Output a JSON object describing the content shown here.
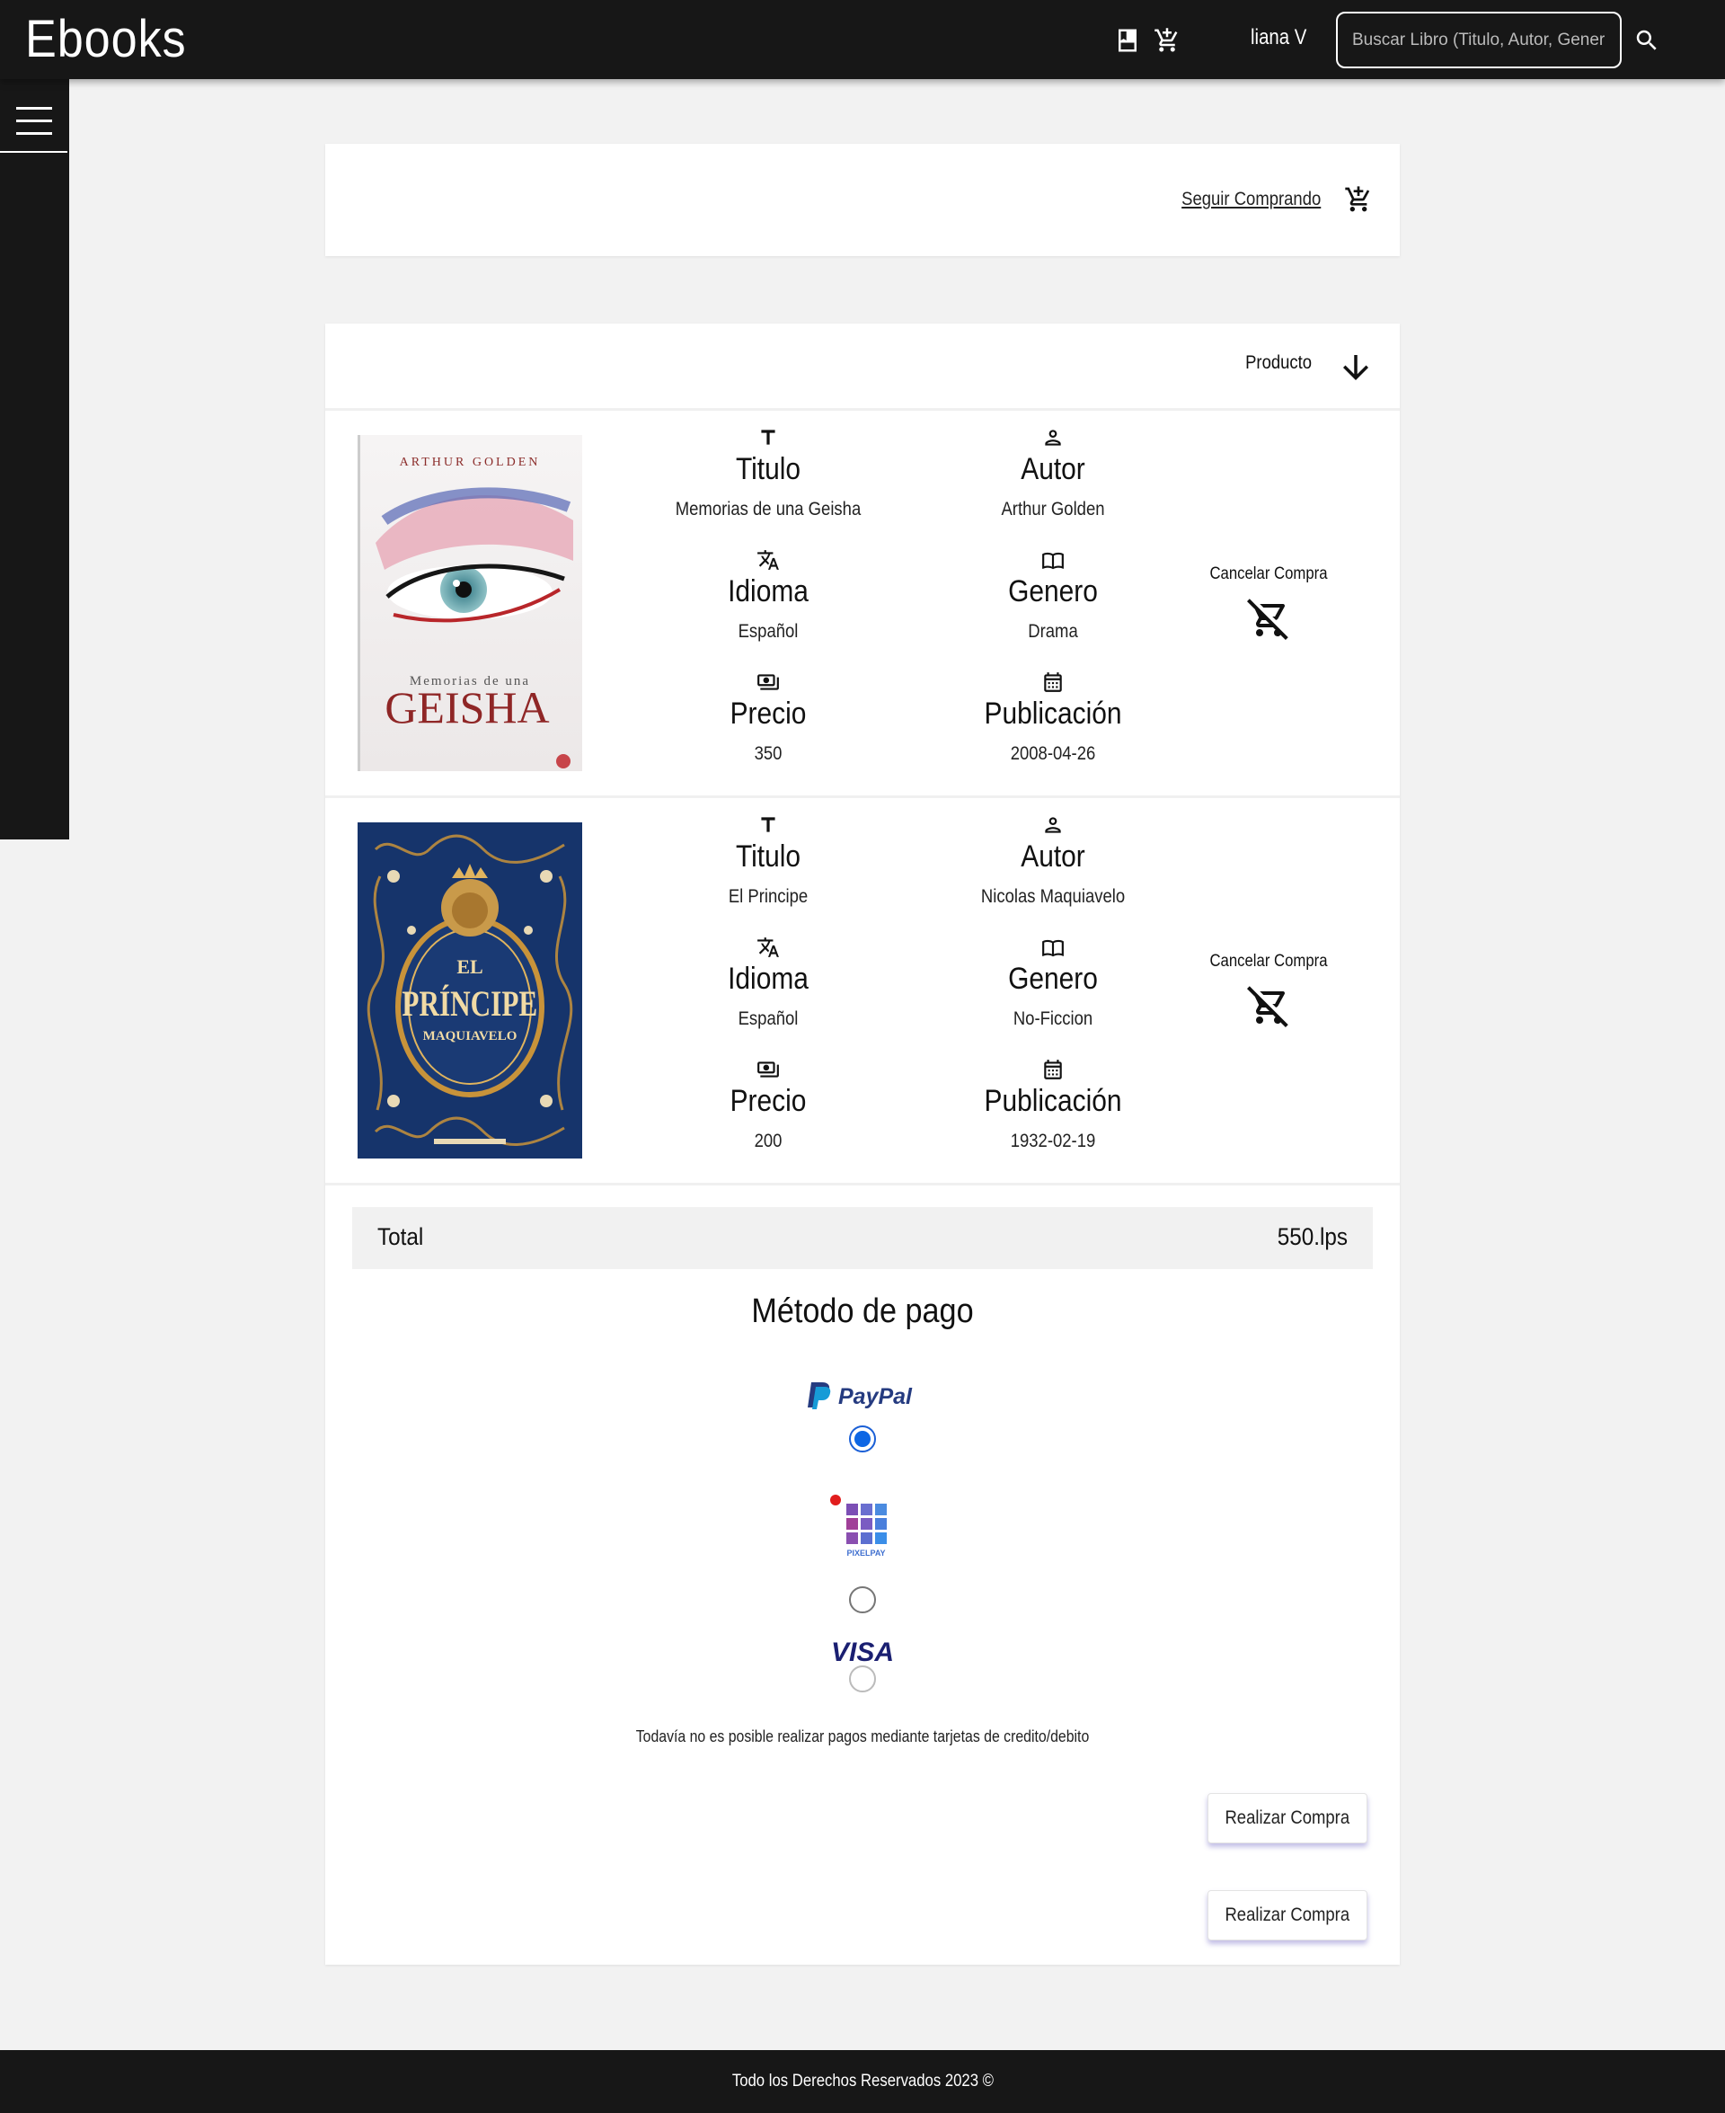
{
  "app": {
    "brand": "Ebooks",
    "user_name": "liana V",
    "search_placeholder": "Buscar Libro (Titulo, Autor, Genero)"
  },
  "cart_header": {
    "continue_label": "Seguir Comprando"
  },
  "list_header": {
    "sort_label": "Producto"
  },
  "field_labels": {
    "title": "Titulo",
    "author": "Autor",
    "language": "Idioma",
    "genre": "Genero",
    "price": "Precio",
    "published": "Publicación"
  },
  "books": [
    {
      "cover_text": {
        "author": "ARTHUR GOLDEN",
        "subtitle": "Memorias de una",
        "title": "GEISHA"
      },
      "title": "Memorias de una Geisha",
      "author": "Arthur Golden",
      "language": "Español",
      "genre": "Drama",
      "price": "350",
      "published": "2008-04-26",
      "cancel_label": "Cancelar Compra"
    },
    {
      "cover_text": {
        "title_top": "EL",
        "title": "PRÍNCIPE",
        "author": "MAQUIAVELO"
      },
      "title": "El Principe",
      "author": "Nicolas Maquiavelo",
      "language": "Español",
      "genre": "No-Ficcion",
      "price": "200",
      "published": "1932-02-19",
      "cancel_label": "Cancelar Compra"
    }
  ],
  "total": {
    "label": "Total",
    "value": "550.lps"
  },
  "payment": {
    "title": "Método de pago",
    "methods": [
      {
        "name": "PayPal",
        "selected": true
      },
      {
        "name": "PIXELPAY",
        "selected": false
      },
      {
        "name": "VISA",
        "selected": false
      }
    ],
    "note": "Todavía no es posible realizar pagos mediante tarjetas de credito/debito"
  },
  "actions": {
    "buy_label_1": "Realizar Compra",
    "buy_label_2": "Realizar Compra"
  },
  "footer": {
    "text": "Todo los Derechos Reservados 2023 ©"
  },
  "colors": {
    "nav_bg": "#171717",
    "page_bg": "#f2f2f2",
    "radio_selected": "#0d66e4",
    "paypal_dark": "#253b80",
    "paypal_light": "#179bd7",
    "visa_blue": "#1a1f71"
  },
  "icons": {
    "top": [
      "book-icon",
      "cart-plus-icon",
      "search-icon"
    ],
    "fields": [
      "text-icon",
      "person-icon",
      "translate-icon",
      "menu-book-icon",
      "payments-icon",
      "calendar-icon"
    ],
    "cancel": "remove-shopping-cart-icon"
  }
}
